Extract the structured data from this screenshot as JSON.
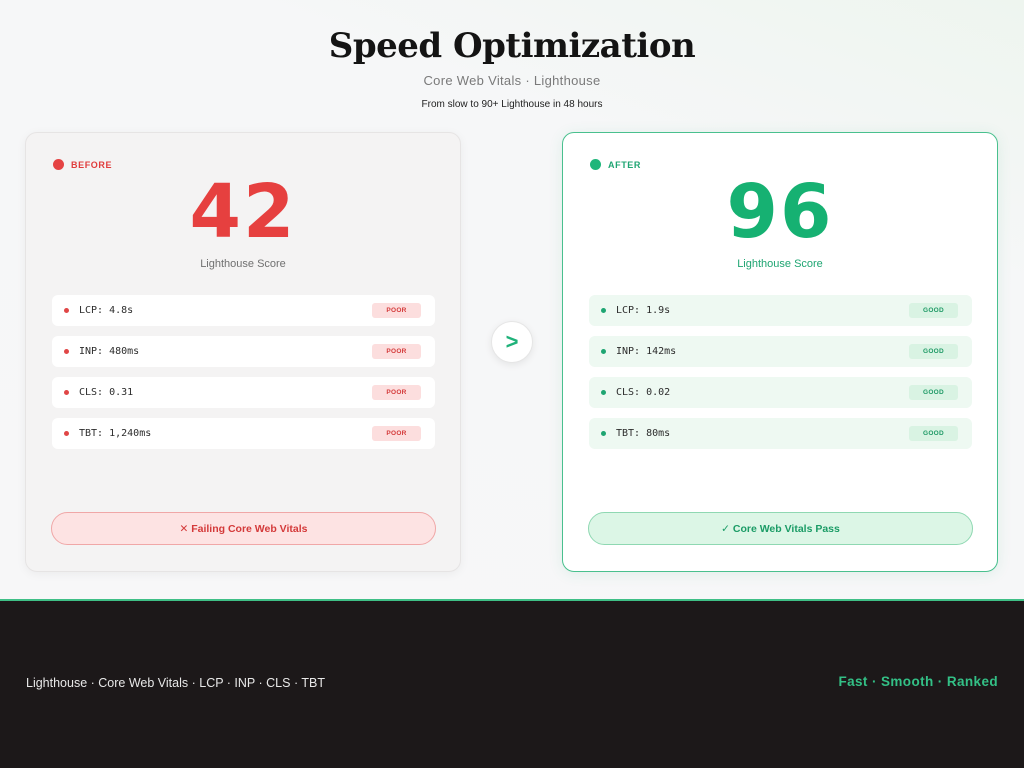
{
  "header": {
    "title": "Speed Optimization",
    "subtitle": "Core Web Vitals · Lighthouse",
    "tagline": "From slow to 90+ Lighthouse in 48 hours"
  },
  "before": {
    "badge": "BEFORE",
    "score": "42",
    "score_label": "Lighthouse Score",
    "metrics": [
      {
        "text": "LCP: 4.8s",
        "status": "POOR"
      },
      {
        "text": "INP: 480ms",
        "status": "POOR"
      },
      {
        "text": "CLS: 0.31",
        "status": "POOR"
      },
      {
        "text": "TBT: 1,240ms",
        "status": "POOR"
      }
    ],
    "status_text": "✕ Failing Core Web Vitals",
    "accent_color": "#e6403f"
  },
  "arrow": {
    "glyph": ">",
    "icon": "chevron-right-icon"
  },
  "after": {
    "badge": "AFTER",
    "score": "96",
    "score_label": "Lighthouse Score",
    "metrics": [
      {
        "text": "LCP: 1.9s",
        "status": "GOOD"
      },
      {
        "text": "INP: 142ms",
        "status": "GOOD"
      },
      {
        "text": "CLS: 0.02",
        "status": "GOOD"
      },
      {
        "text": "TBT: 80ms",
        "status": "GOOD"
      }
    ],
    "status_text": "✓ Core Web Vitals Pass",
    "accent_color": "#16b172"
  },
  "footer": {
    "left": "Lighthouse · Core Web Vitals · LCP · INP · CLS · TBT",
    "right": "Fast · Smooth · Ranked"
  }
}
